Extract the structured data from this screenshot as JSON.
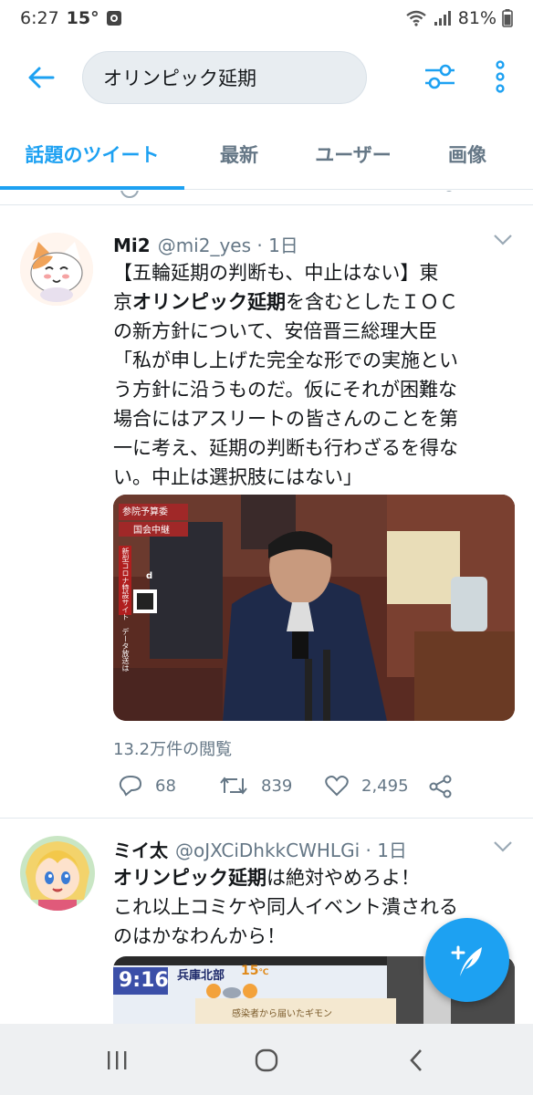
{
  "status_bar": {
    "time": "6:27",
    "temp": "15°",
    "battery": "81%"
  },
  "search": {
    "query": "オリンピック延期"
  },
  "tabs": [
    {
      "label": "話題のツイート",
      "active": true
    },
    {
      "label": "最新",
      "active": false
    },
    {
      "label": "ユーザー",
      "active": false
    },
    {
      "label": "画像",
      "active": false
    }
  ],
  "tweets": [
    {
      "display_name": "Mi2",
      "handle": "@mi2_yes · 1日",
      "text_lines": [
        [
          "【五輪延期の判断も、中止はない】東",
          ""
        ],
        [
          "京",
          "オリンピック延期",
          "を含むとしたＩＯＣ"
        ],
        [
          "の新方針について、安倍晋三総理大臣"
        ],
        [
          "「私が申し上げた完全な形での実施とい"
        ],
        [
          "う方針に沿うものだ。仮にそれが困難な"
        ],
        [
          "場合にはアスリートの皆さんのことを第"
        ],
        [
          "一に考え、延期の判断も行わざるを得な"
        ],
        [
          "い。中止は選択肢にはない」"
        ]
      ],
      "media_overlay": {
        "label1": "参院予算委",
        "label2": "国会中継",
        "side": "新型コロナ特設サイト　データ放送は",
        "badge": "d"
      },
      "views": "13.2万件の閲覧",
      "replies": "68",
      "retweets": "839",
      "likes": "2,495"
    },
    {
      "display_name": "ミイ太",
      "handle": "@oJXCiDhkkCWHLGi · 1日",
      "line1_bold": "オリンピック延期",
      "line1_rest": "は絶対やめろよ！",
      "line2": "これ以上コミケや同人イベント潰される",
      "line3": "のはかなわんから！",
      "media_overlay": {
        "time": "9:16",
        "region": "兵庫北部",
        "temp": "15",
        "temp_unit": "℃",
        "banner": "感染者から届いたギモン"
      }
    }
  ],
  "colors": {
    "accent": "#1da1f2",
    "text": "#14171a",
    "muted": "#657786",
    "border": "#e1e8ed"
  }
}
